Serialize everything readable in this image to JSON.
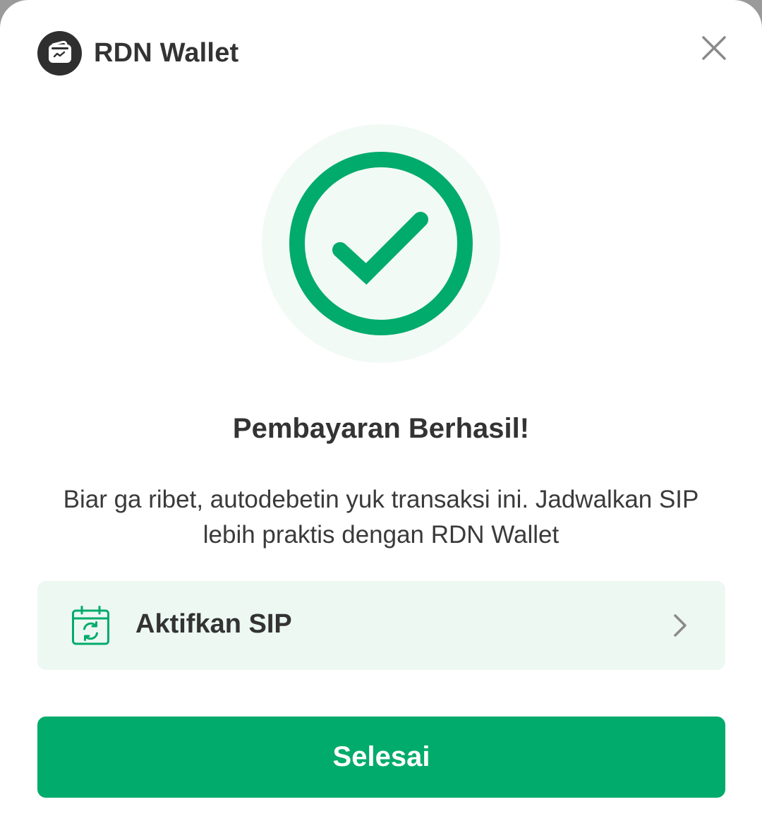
{
  "header": {
    "brand_name": "RDN Wallet",
    "logo_icon": "wallet-icon",
    "close_icon": "close-icon"
  },
  "hero": {
    "icon": "check-circle-icon",
    "accent_color": "#00ab6b"
  },
  "result": {
    "title": "Pembayaran Berhasil!",
    "description": "Biar ga ribet, autodebetin yuk transaksi ini. Jadwalkan SIP lebih praktis dengan RDN Wallet"
  },
  "sip_card": {
    "icon": "calendar-refresh-icon",
    "label": "Aktifkan SIP",
    "chevron_icon": "chevron-right-icon"
  },
  "actions": {
    "done_label": "Selesai"
  },
  "colors": {
    "primary": "#00ab6b",
    "card_background": "#edf8f3",
    "text": "#333333"
  }
}
